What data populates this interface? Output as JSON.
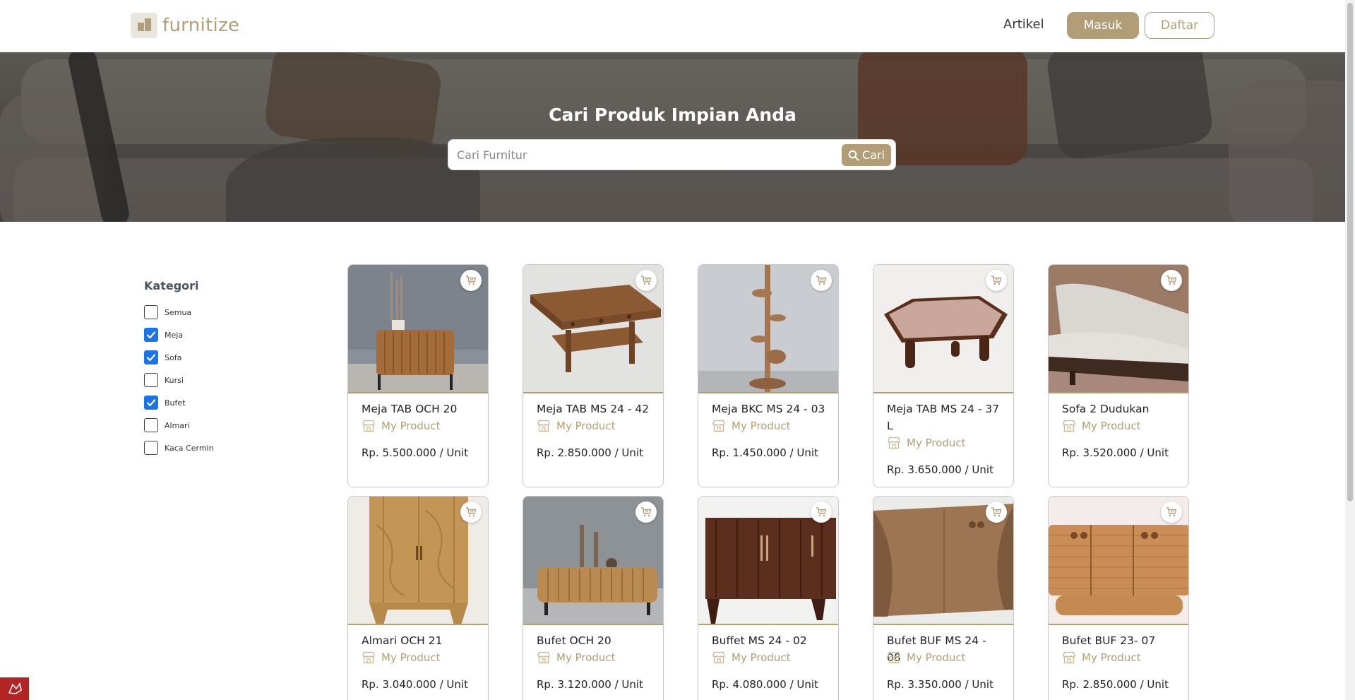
{
  "header": {
    "logo_text": "furnitize",
    "nav_artikel": "Artikel",
    "btn_masuk": "Masuk",
    "btn_daftar": "Daftar"
  },
  "hero": {
    "title": "Cari Produk Impian Anda",
    "search_placeholder": "Cari Furnitur",
    "search_button": "Cari"
  },
  "sidebar": {
    "title": "Kategori",
    "categories": [
      {
        "label": "Semua",
        "checked": false
      },
      {
        "label": "Meja",
        "checked": true
      },
      {
        "label": "Sofa",
        "checked": true
      },
      {
        "label": "Kursi",
        "checked": false
      },
      {
        "label": "Bufet",
        "checked": true
      },
      {
        "label": "Almari",
        "checked": false
      },
      {
        "label": "Kaca Cermin",
        "checked": false
      }
    ]
  },
  "products": [
    {
      "name": "Meja TAB OCH 20",
      "store": "My Product",
      "price": "Rp. 5.500.000 / Unit"
    },
    {
      "name": "Meja TAB MS 24 - 42",
      "store": "My Product",
      "price": "Rp. 2.850.000 / Unit"
    },
    {
      "name": "Meja BKC MS 24 - 03",
      "store": "My Product",
      "price": "Rp. 1.450.000 / Unit"
    },
    {
      "name": "Meja TAB MS 24 - 37 L",
      "store": "My Product",
      "price": "Rp. 3.650.000 / Unit"
    },
    {
      "name": "Sofa 2 Dudukan",
      "store": "My Product",
      "price": "Rp. 3.520.000 / Unit"
    },
    {
      "name": "Almari OCH 21",
      "store": "My Product",
      "price": "Rp. 3.040.000 / Unit"
    },
    {
      "name": "Bufet OCH 20",
      "store": "My Product",
      "price": "Rp. 3.120.000 / Unit"
    },
    {
      "name": "Buffet MS 24 - 02",
      "store": "My Product",
      "price": "Rp. 4.080.000 / Unit"
    },
    {
      "name": "Bufet BUF MS 24 - 08",
      "store": "My Product",
      "price": "Rp. 3.350.000 / Unit"
    },
    {
      "name": "Bufet BUF 23- 07",
      "store": "My Product",
      "price": "Rp. 2.850.000 / Unit"
    }
  ],
  "colors": {
    "accent": "#b29e76",
    "checkbox": "#1a73e8"
  }
}
